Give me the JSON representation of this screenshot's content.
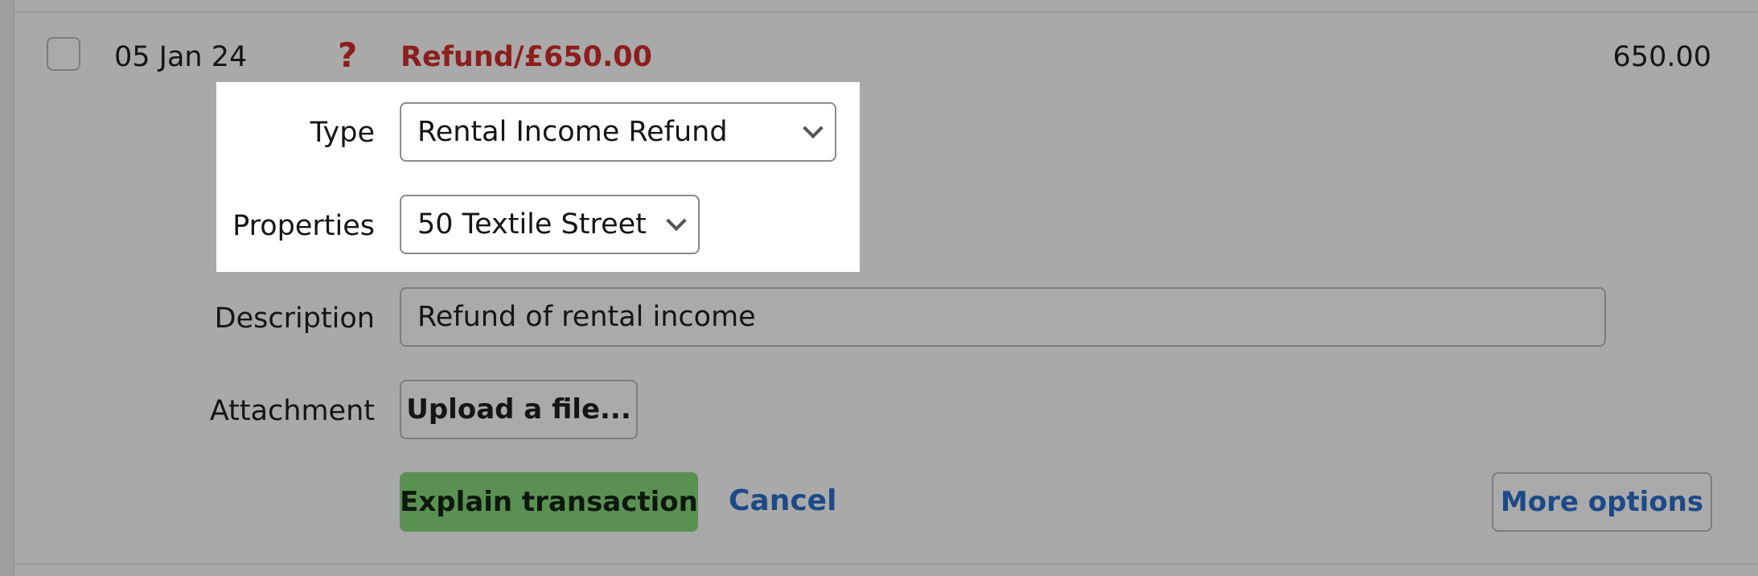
{
  "transaction": {
    "date": "05 Jan 24",
    "status_icon": "question-icon",
    "title": "Refund/£650.00",
    "amount": "650.00"
  },
  "form": {
    "type": {
      "label": "Type",
      "value": "Rental Income Refund"
    },
    "properties": {
      "label": "Properties",
      "value": "50 Textile Street"
    },
    "description": {
      "label": "Description",
      "value": "Refund of rental income"
    },
    "attachment": {
      "label": "Attachment",
      "button_label": "Upload a file..."
    }
  },
  "actions": {
    "explain_label": "Explain transaction",
    "cancel_label": "Cancel",
    "more_options_label": "More options"
  },
  "colors": {
    "title_red": "#8d1e1e",
    "link_blue": "#1d4a87",
    "explain_green": "#5a9153",
    "dim_overlay": "#a9a9a9"
  }
}
